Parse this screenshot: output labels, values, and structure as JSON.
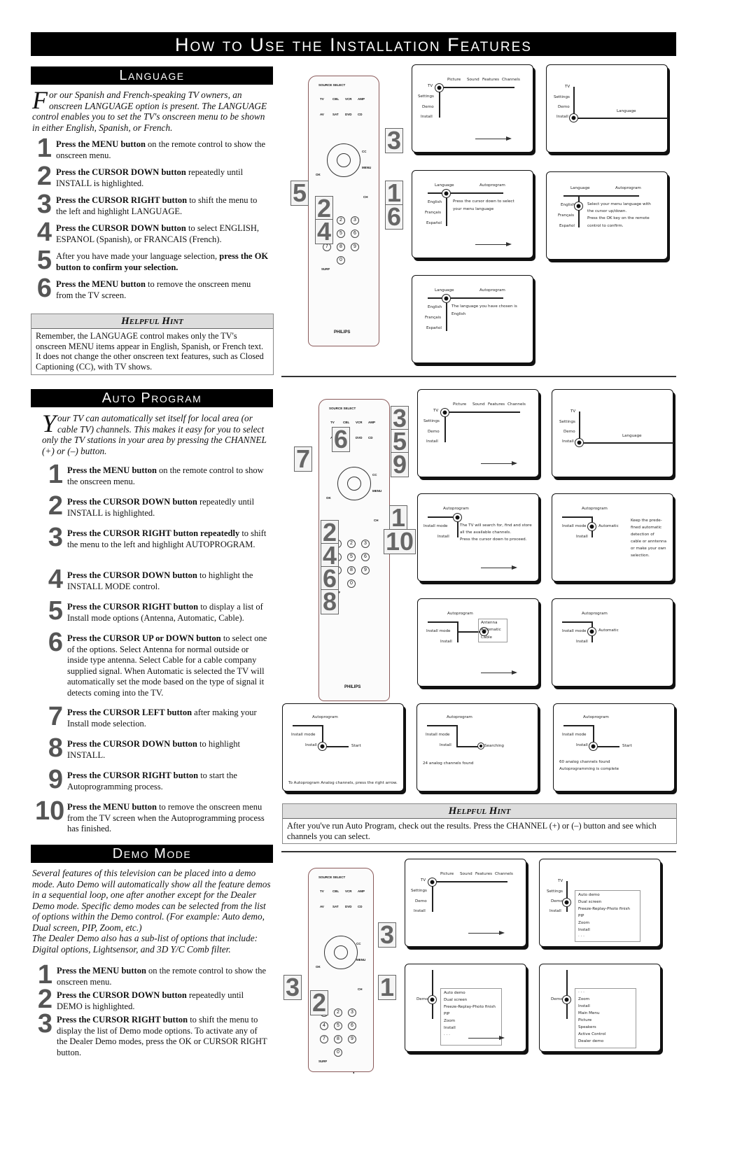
{
  "title": "How to Use the Installation Features",
  "page_number": "4",
  "language": {
    "header": "Language",
    "intro_cap": "F",
    "intro": "or our Spanish and French-speaking TV owners, an onscreen LANGUAGE option is present.  The LANGUAGE control enables you to set the TV's onscreen menu to be shown in either English, Spanish, or French.",
    "steps": [
      {
        "n": "1",
        "b": "Press the MENU button",
        "t": " on the remote control to show the onscreen menu."
      },
      {
        "n": "2",
        "b": "Press the CURSOR DOWN button",
        "t": " repeatedly until INSTALL is highlighted."
      },
      {
        "n": "3",
        "b": "Press the CURSOR RIGHT button",
        "t": " to shift the menu to the left and highlight LANGUAGE."
      },
      {
        "n": "4",
        "b": "Press the CURSOR DOWN button",
        "t": " to select ENGLISH, ESPANOL (Spanish), or FRANCAIS (French)."
      },
      {
        "n": "5",
        "pre": "After you have made your language selection, ",
        "b": "press the OK button to confirm your selection.",
        "t": ""
      },
      {
        "n": "6",
        "b": "Press the MENU button",
        "t": " to remove the onscreen menu from the TV screen."
      }
    ],
    "hint_title": "Helpful Hint",
    "hint": "Remember, the LANGUAGE control makes only the TV's onscreen MENU items appear in English, Spanish, or French text.  It does not change the other onscreen text features, such as Closed Captioning (CC), with TV shows.",
    "callouts": [
      "3",
      "5",
      "2",
      "4",
      "1",
      "6"
    ]
  },
  "autoprogram": {
    "header": "Auto Program",
    "intro_cap": "Y",
    "intro": "our TV can automatically set itself for local area (or cable TV) channels.  This makes it easy for you to select only the TV stations in your area by pressing the CHANNEL (+) or (–) button.",
    "steps": [
      {
        "n": "1",
        "b": "Press the MENU button",
        "t": " on the remote control to show the onscreen menu."
      },
      {
        "n": "2",
        "b": "Press the CURSOR DOWN button",
        "t": " repeatedly until INSTALL is highlighted."
      },
      {
        "n": "3",
        "b": "Press the CURSOR RIGHT button repeatedly",
        "t": " to shift the menu to the left and highlight AUTOPROGRAM."
      },
      {
        "n": "4",
        "b": "Press the CURSOR DOWN button",
        "t": " to highlight the INSTALL MODE control."
      },
      {
        "n": "5",
        "b": "Press the CURSOR RIGHT button",
        "t": " to display a list of Install mode options (Antenna, Automatic, Cable)."
      },
      {
        "n": "6",
        "b": "Press the CURSOR UP or DOWN button",
        "t": " to select one of the options. Select Antenna for normal outside or inside type antenna. Select Cable for a cable company supplied signal. When Automatic is selected the TV will automatically set the mode based on the type of signal it detects coming into the TV."
      },
      {
        "n": "7",
        "b": "Press the CURSOR LEFT button",
        "t": " after making your Install mode selection."
      },
      {
        "n": "8",
        "b": "Press the CURSOR DOWN button",
        "t": " to highlight INSTALL."
      },
      {
        "n": "9",
        "b": "Press the CURSOR RIGHT button",
        "t": " to start the Autoprogramming process."
      },
      {
        "n": "10",
        "b": "Press the MENU button",
        "t": " to remove the onscreen menu from the TV screen when the Autoprogramming process has finished."
      }
    ],
    "hint_title": "Helpful Hint",
    "hint": "After you've run Auto Program, check out the results.  Press the CHANNEL (+) or (–) button and see which channels you can select.",
    "callouts": [
      "3",
      "5",
      "9",
      "6",
      "7",
      "1",
      "10",
      "2",
      "4",
      "6",
      "8"
    ]
  },
  "demo": {
    "header": "Demo Mode",
    "intro": "Several features of this television can be placed into a demo mode.  Auto Demo will automatically show all the feature demos in a sequential loop, one after another except for the Dealer Demo mode. Specific demo modes can be selected from the list of options within the Demo control. (For example: Auto demo, Dual screen, PIP, Zoom, etc.)",
    "intro2": "The Dealer Demo also has a sub-list of options that include: Digital options, Lightsensor, and 3D Y/C Comb filter.",
    "steps": [
      {
        "n": "1",
        "b": "Press the MENU button",
        "t": " on the remote control to show the onscreen menu."
      },
      {
        "n": "2",
        "b": "Press the CURSOR DOWN button",
        "t": " repeatedly until DEMO is highlighted."
      },
      {
        "n": "3",
        "b": "Press the CURSOR RIGHT button",
        "t": " to shift the menu to display the list of Demo mode options.  To activate any of the Dealer Demo modes, press the OK or CURSOR RIGHT button."
      }
    ],
    "callouts": [
      "3",
      "3",
      "2",
      "1"
    ]
  },
  "menu": {
    "top": [
      "Picture",
      "Sound",
      "Features",
      "Channels"
    ],
    "side": [
      "TV",
      "Settings",
      "Demo",
      "Install"
    ],
    "language": "Language",
    "autoprogram": "Autoprogram",
    "langs": [
      "English",
      "Français",
      "Español"
    ],
    "lang_msg1": [
      "Press the cursor down to select",
      "your menu language"
    ],
    "lang_msg2": [
      "Select your menu language with",
      "the cursor up/down.",
      "Press the OK key on the remote",
      "control to confirm."
    ],
    "lang_msg3": [
      "The language you have chosen is",
      "English"
    ],
    "install_mode": "Install mode",
    "install": "Install",
    "ap_msg1": [
      "The TV will search for, find and store",
      "all the available channels.",
      "Press the cursor down to proceed."
    ],
    "automatic": "Automatic",
    "ap_msg2": [
      "Keep the prede-",
      "fined automatic",
      "detection of",
      "cable or anntenna",
      "or make your own",
      "selection."
    ],
    "modes": [
      "Antenna",
      "Automatic",
      "Cable"
    ],
    "start": "Start",
    "searching": "Searching",
    "ap_hint": "To Autoprogram Analog channels, press the right arrow.",
    "found24": "24 analog channels found",
    "found60": "60 analog channels found",
    "complete": "Autoprogramming is complete",
    "demo_list": [
      "Auto demo",
      "Dual screen",
      "Freeze-Replay-Photo finish",
      "PIP",
      "Zoom",
      "Install",
      "· · ·"
    ],
    "dealer_list": [
      "· · ·",
      "Zoom",
      "Install",
      "Main Menu",
      "Picture",
      "Speakers",
      "Active Control",
      "Dealer demo"
    ]
  },
  "remote": {
    "brand": "PHILIPS",
    "labels": [
      "SOURCE SELECT",
      "TV",
      "CBL",
      "VCR",
      "AMP",
      "AV",
      "SAT",
      "DVD",
      "CD",
      "MENU",
      "OK",
      "CH",
      "CC",
      "SURF"
    ],
    "digits": [
      "1",
      "2",
      "3",
      "4",
      "5",
      "6",
      "7",
      "8",
      "9",
      "0"
    ]
  }
}
